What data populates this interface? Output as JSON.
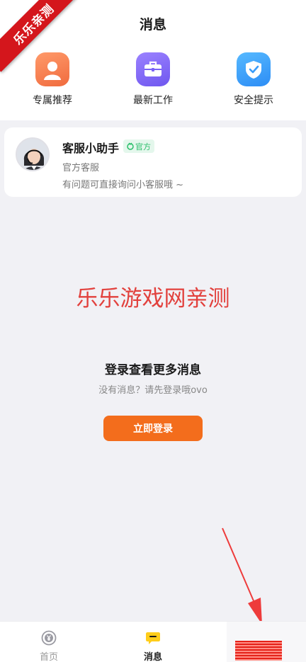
{
  "header": {
    "title": "消息"
  },
  "ribbon": {
    "text": "乐乐亲测"
  },
  "shortcuts": [
    {
      "label": "专属推荐",
      "icon": "person-icon",
      "color": "#f57545"
    },
    {
      "label": "最新工作",
      "icon": "briefcase-icon",
      "color": "#7a62f6"
    },
    {
      "label": "安全提示",
      "icon": "shield-check-icon",
      "color": "#3a9cf9"
    }
  ],
  "service": {
    "name": "客服小助手",
    "badge": "官方",
    "subtitle": "官方客服",
    "message": "有问题可直接询问小客服哦 ~"
  },
  "watermark": {
    "text": "乐乐游戏网亲测"
  },
  "login": {
    "title": "登录查看更多消息",
    "subtitle": "没有消息？请先登录哦ovo",
    "button": "立即登录"
  },
  "tabbar": {
    "items": [
      {
        "label": "首页",
        "icon": "yen-coin-icon",
        "active": false
      },
      {
        "label": "消息",
        "icon": "chat-bubble-icon",
        "active": true
      }
    ]
  },
  "colors": {
    "accent": "#f36d1c",
    "badge_green": "#2bbf6a",
    "watermark_red": "#e2413d"
  }
}
